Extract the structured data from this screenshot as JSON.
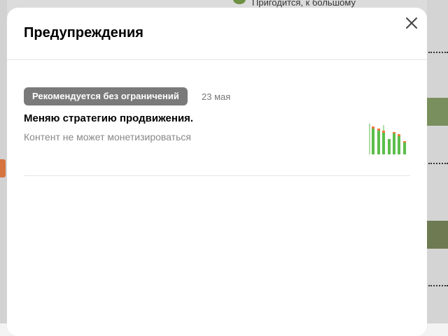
{
  "modal": {
    "title": "Предупреждения",
    "close_icon": "close-icon"
  },
  "warnings": [
    {
      "status": "Рекомендуется без ограничений",
      "date": "23 мая",
      "title": "Меняю стратегию продвижения.",
      "subtitle": "Контент не может монетизироваться",
      "thumbnail_icon": "chart-thumbnail-icon"
    }
  ],
  "background": {
    "feed_text": "Пригодится, к большому"
  },
  "colors": {
    "badge_bg": "#7a7a7a",
    "chart_green": "#5cbd4a",
    "chart_orange": "#f07b3f"
  }
}
